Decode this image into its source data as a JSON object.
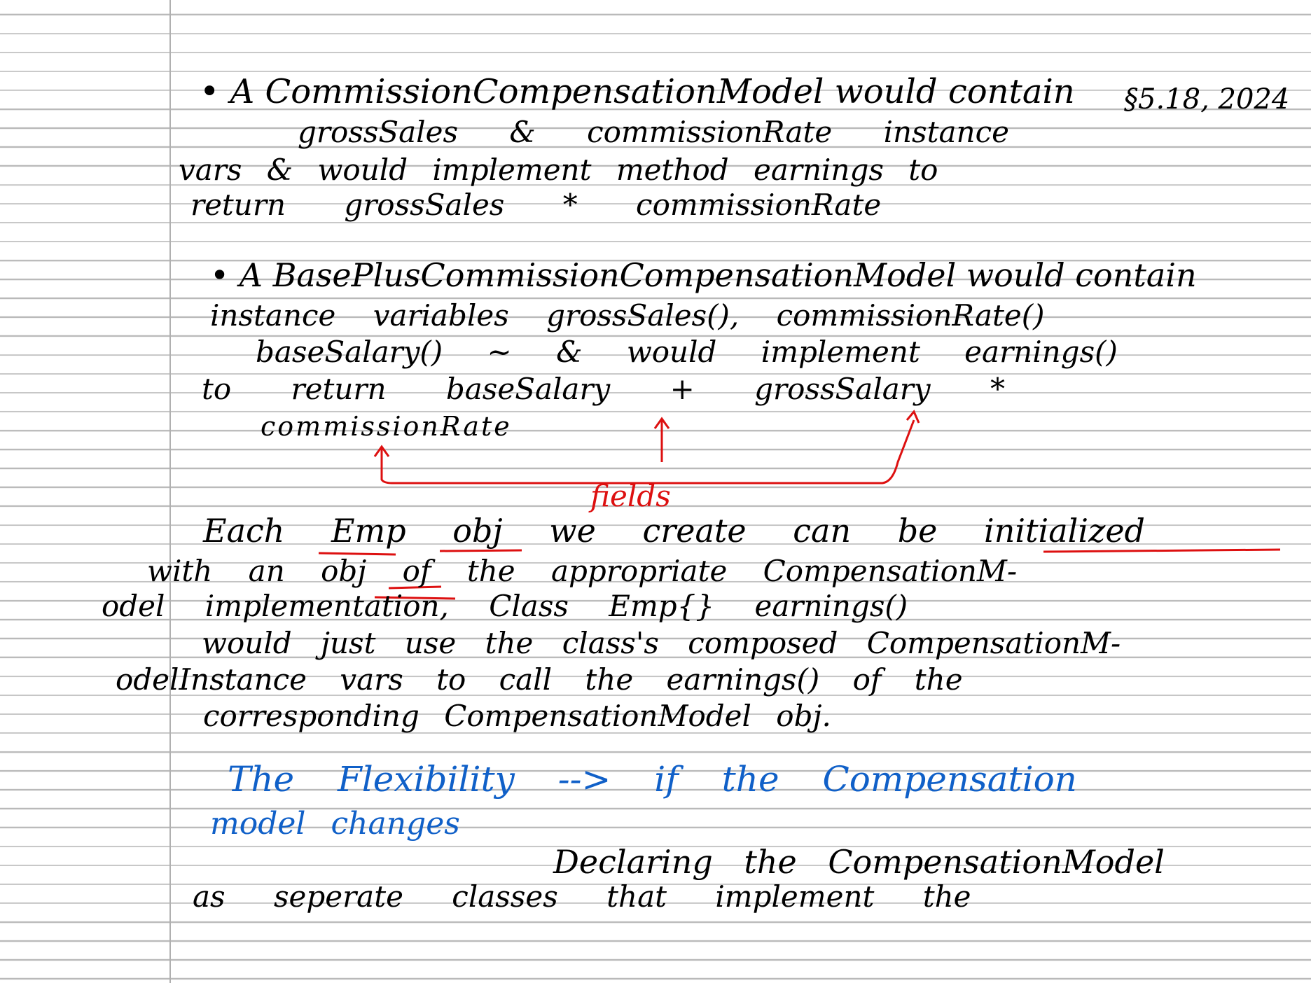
{
  "note": {
    "lines": [
      "• A CommissionCompensationModel would contain",
      "grossSales & commissionRate instance",
      "vars & would implement method earnings to",
      "return grossSales * commissionRate",
      "• A BasePlusCommissionCompensationModel would contain",
      "instance variables grossSales(), commissionRate()",
      "baseSalary() ~ & would implement earnings()",
      "to return baseSalary + grossSalary *",
      "commissionRate",
      "fields",
      "Each Emp obj we create can be initialized",
      "with an obj of the appropriate CompensationM-",
      "odel implementation, Class Emp{} earnings()",
      "would just use the class's composed CompensationM-",
      "odelInstance vars to call the earnings() of the",
      "corresponding CompensationModel obj.",
      "The Flexibility --> if the Compensation",
      "model changes",
      "Declaring the CompensationModel",
      "as seperate classes that implement the"
    ],
    "margin_note": "§5.18, 2024"
  },
  "colors": {
    "ink": "#000000",
    "red_annotation": "#dd1010",
    "blue_annotation": "#1060c8",
    "rule_lines": "#b9b9b9"
  }
}
